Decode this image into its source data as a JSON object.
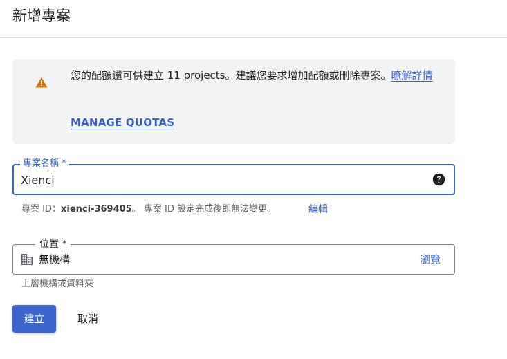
{
  "header": {
    "title": "新增專案"
  },
  "quota_notice": {
    "message": "您的配額還可供建立 11 projects。建議您要求增加配額或刪除專案。",
    "learn_more_label": "瞭解詳情",
    "manage_quotas_label": "MANAGE QUOTAS",
    "icon": "warning-triangle-icon",
    "icon_color": "#e37400"
  },
  "project_name": {
    "label": "專案名稱 *",
    "value": "Xienci",
    "help_icon": "help-circle-icon"
  },
  "project_id": {
    "prefix": "專案 ID：",
    "value": "xienci-369405",
    "suffix": "。 專案 ID 設定完成後即無法變更。",
    "edit_label": "編輯"
  },
  "location": {
    "label": "位置 *",
    "value": "無機構",
    "browse_label": "瀏覽",
    "helper": "上層機構或資料夾",
    "icon": "building-icon"
  },
  "actions": {
    "create_label": "建立",
    "cancel_label": "取消"
  },
  "colors": {
    "accent": "#3b65cc",
    "link": "#3c5fc6",
    "notice_bg": "#f1f3f4"
  }
}
